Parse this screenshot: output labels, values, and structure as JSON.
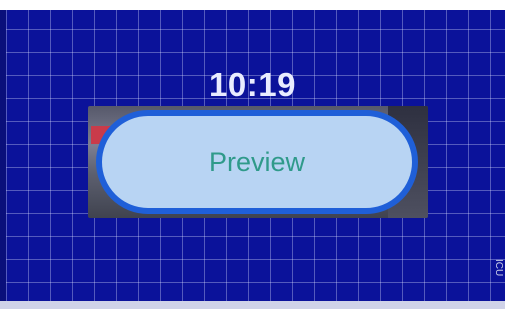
{
  "lock_screen": {
    "time": "10:19"
  },
  "preview_button": {
    "label": "Preview"
  },
  "corner_logo": {
    "text": "ICU"
  },
  "colors": {
    "background": "#0b129a",
    "grid": "#dce1ff",
    "pill_fill": "#b8d4f3",
    "pill_border": "#1f5fd8",
    "label_text": "#2f9a8a"
  },
  "icons": {
    "corner": "logo-icon"
  }
}
